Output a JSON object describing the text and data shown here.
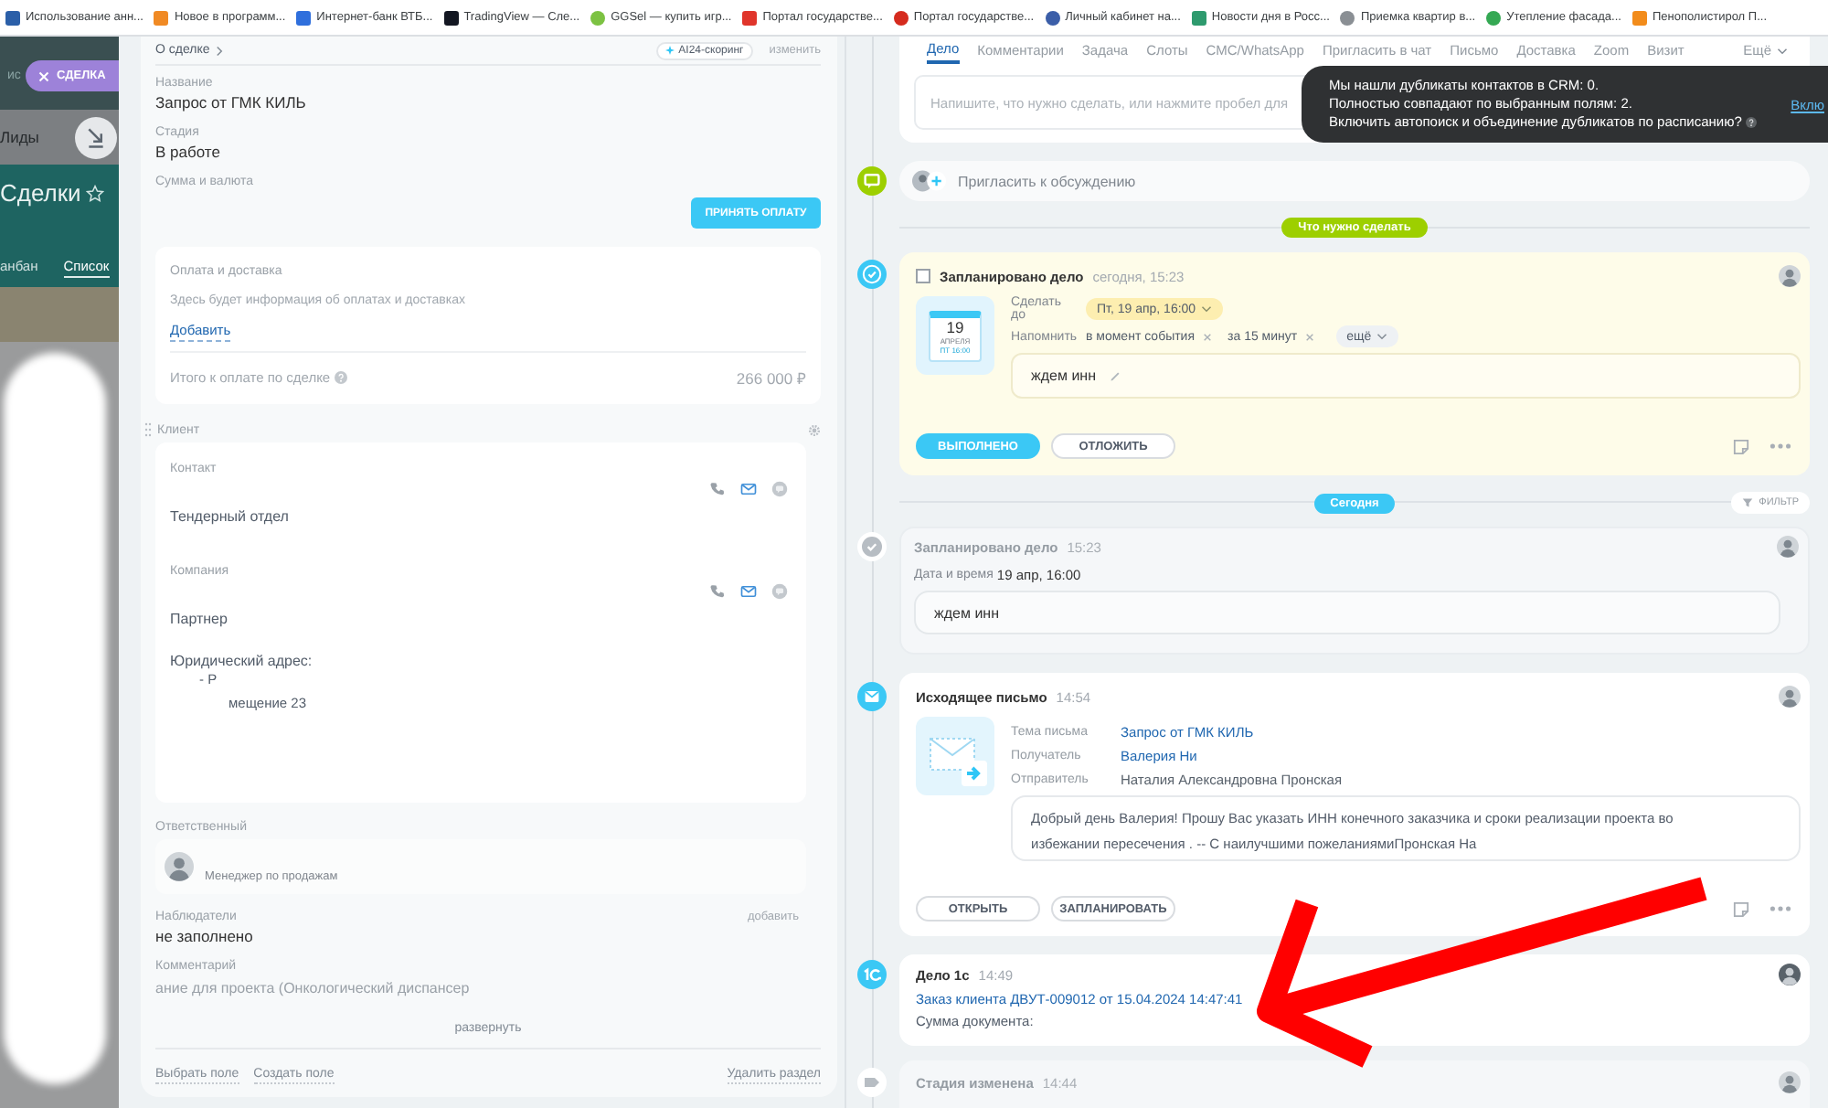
{
  "bookmarks": [
    {
      "label": "Использование анн...",
      "color": "#2b5fa8",
      "kind": "square"
    },
    {
      "label": "Новое в программ...",
      "color": "#f08a24",
      "kind": "square"
    },
    {
      "label": "Интернет-банк ВТБ...",
      "color": "#2f6fdc",
      "kind": "square"
    },
    {
      "label": "TradingView — Сле...",
      "color": "#131722",
      "kind": "square"
    },
    {
      "label": "GGSel — купить игр...",
      "color": "#7cc242",
      "kind": "circle"
    },
    {
      "label": "Портал государстве...",
      "color": "#e0352b",
      "kind": "square"
    },
    {
      "label": "Портал государстве...",
      "color": "#d52b1e",
      "kind": "circle"
    },
    {
      "label": "Личный кабинет на...",
      "color": "#3b5ea8",
      "kind": "circle"
    },
    {
      "label": "Новости дня в Росс...",
      "color": "#2e9a6e",
      "kind": "square"
    },
    {
      "label": "Приемка квартир в...",
      "color": "#8a8f94",
      "kind": "circle"
    },
    {
      "label": "Утепление фасада...",
      "color": "#34a853",
      "kind": "circle"
    },
    {
      "label": "Пенополистирол П...",
      "color": "#f28c1b",
      "kind": "square"
    }
  ],
  "crm_background": {
    "search_fragment": "ис",
    "close_tab": "СДЕЛКА",
    "menu_item": "Лиды",
    "title": "Сделки",
    "views": [
      {
        "label": "анбан",
        "selected": false
      },
      {
        "label": "Список",
        "selected": true
      }
    ]
  },
  "deal": {
    "section_title": "О сделке",
    "scoring": "AI24-скоринг",
    "edit": "изменить",
    "fields": [
      {
        "label": "Название",
        "value": "Запрос от ГМК КИЛЬ"
      },
      {
        "label": "Стадия",
        "value": "В работе"
      }
    ],
    "amount_label": "Сумма и валюта",
    "accept_payment": "ПРИНЯТЬ ОПЛАТУ",
    "payment": {
      "title": "Оплата и доставка",
      "hint": "Здесь будет информация об оплатах и доставках",
      "add": "Добавить",
      "total_label": "Итого к оплате по сделке",
      "total": "266 000 ₽"
    },
    "client": {
      "title": "Клиент",
      "entries": [
        {
          "label": "Контакт",
          "detail": "Тендерный отдел"
        },
        {
          "label": "Компания",
          "detail": "Партнер"
        }
      ],
      "address_label": "Юридический адрес:",
      "address_lines": [
        "- Р",
        "мещение 23"
      ]
    },
    "responsible": {
      "label": "Ответственный",
      "role": "Менеджер по продажам"
    },
    "observers": {
      "label": "Наблюдатели",
      "add": "добавить",
      "value": "не заполнено"
    },
    "comment": {
      "label": "Комментарий",
      "text": "ание для проекта (Онкологический диспансер",
      "expand": "развернуть"
    },
    "footer": {
      "choose": "Выбрать поле",
      "create": "Создать поле",
      "delete": "Удалить раздел"
    }
  },
  "timeline": {
    "tabs": [
      {
        "label": "Дело",
        "selected": true
      },
      {
        "label": "Комментарии",
        "selected": false
      },
      {
        "label": "Задача",
        "selected": false
      },
      {
        "label": "Слоты",
        "selected": false
      },
      {
        "label": "СМС/WhatsApp",
        "selected": false
      },
      {
        "label": "Пригласить в чат",
        "selected": false
      },
      {
        "label": "Письмо",
        "selected": false
      },
      {
        "label": "Доставка",
        "selected": false
      },
      {
        "label": "Zoom",
        "selected": false
      },
      {
        "label": "Визит",
        "selected": false
      }
    ],
    "more_tab": "Ещё",
    "composer_placeholder": "Напишите, что нужно сделать, или нажмите пробел для",
    "items": [
      {
        "kind": "invite",
        "placeholder": "Пригласить к обсуждению"
      },
      {
        "kind": "divider",
        "label": "Что нужно сделать",
        "color": "#9dcf00"
      },
      {
        "kind": "task",
        "checked": false,
        "title": "Запланировано дело",
        "time": "сегодня, 15:23",
        "calendar": {
          "day": "19",
          "month": "АПРЕЛЯ",
          "time": "ПТ 16:00"
        },
        "deadline_label": "Сделать до",
        "deadline": "Пт, 19 апр, 16:00",
        "remind_label": "Напомнить",
        "reminders": [
          "в момент события",
          "за 15 минут"
        ],
        "more": "ещё",
        "note": "ждем инн",
        "actions": [
          {
            "label": "ВЫПОЛНЕНО",
            "primary": true
          },
          {
            "label": "ОТЛОЖИТЬ",
            "primary": false
          }
        ]
      },
      {
        "kind": "divider",
        "label": "Сегодня",
        "color": "#3bc8f5",
        "filter": "ФИЛЬТР"
      },
      {
        "kind": "task_done",
        "title": "Запланировано дело",
        "time": "15:23",
        "date_label": "Дата и время",
        "date": "19 апр, 16:00",
        "note": "ждем инн"
      },
      {
        "kind": "email",
        "title": "Исходящее письмо",
        "time": "14:54",
        "rows": [
          {
            "label": "Тема письма",
            "value": "Запрос от ГМК КИЛЬ",
            "kind": "link"
          },
          {
            "label": "Получатель",
            "value": "Валерия Ни",
            "kind": "link"
          },
          {
            "label": "Отправитель",
            "value": "Наталия Александровна Пронская",
            "kind": "text"
          }
        ],
        "body": "Добрый день Валерия! Прошу Вас указать ИНН конечного заказчика и сроки реализации проекта во избежании пересечения . -- С наилучшими пожеланиямиПронская На",
        "actions": [
          {
            "label": "ОТКРЫТЬ",
            "primary": false
          },
          {
            "label": "ЗАПЛАНИРОВАТЬ",
            "primary": false
          }
        ]
      },
      {
        "kind": "doc",
        "title": "Дело 1с",
        "time": "14:49",
        "link": "Заказ клиента ДВУТ-009012 от 15.04.2024 14:47:41",
        "sum_label": "Сумма документа:"
      },
      {
        "kind": "stage",
        "title": "Стадия изменена",
        "time": "14:44"
      }
    ]
  },
  "toast": {
    "lines": [
      "Мы нашли дубликаты контактов в CRM: 0.",
      "Полностью совпадают по выбранным полям: 2.",
      "Включить автопоиск и объединение дубликатов по расписанию?"
    ],
    "action": "Вклю"
  }
}
